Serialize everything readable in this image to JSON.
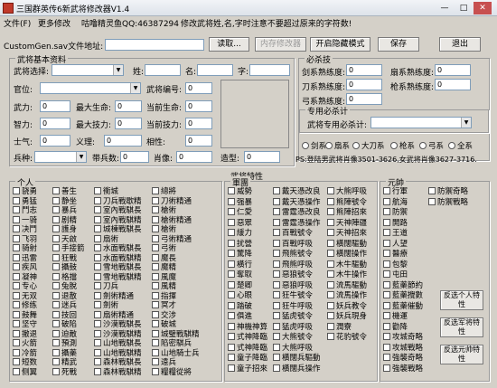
{
  "window": {
    "title": "三国群英传6新武将修改器V1.4",
    "min": "—",
    "max": "□",
    "close": "✕"
  },
  "menu": {
    "file": "文件(F)",
    "more": "更多修改",
    "author": "咕噜精灵鱼QQ:46387294",
    "tip": "修改武将姓,名,字时注意不要超过原来的字符数!"
  },
  "file_row": {
    "label": "CustomGen.sav文件地址:",
    "path": "",
    "read": "读取...",
    "memory": "内存修改器",
    "hidden_mode": "开启隐藏模式",
    "save": "保存",
    "exit": "退出"
  },
  "general": {
    "group": "武将基本资料",
    "select_label": "武将选择:",
    "select_value": "",
    "surname_label": "姓:",
    "name_label": "名:",
    "style_label": "字:",
    "rank_label": "官位:",
    "id_label": "武将编号:",
    "id_value": "0",
    "force_label": "武力:",
    "force": "0",
    "maxhp_label": "最大生命:",
    "maxhp": "0",
    "hp_label": "当前生命:",
    "hp": "0",
    "intel_label": "智力:",
    "intel": "0",
    "maxsp_label": "最大技力:",
    "maxsp": "0",
    "sp_label": "当前技力:",
    "sp": "0",
    "morale_label": "士气:",
    "morale": "0",
    "loyalty_label": "义理:",
    "loyalty": "0",
    "affinity_label": "相性:",
    "affinity": "0",
    "troop_label": "兵种:",
    "troops_label": "带兵数:",
    "troops": "0",
    "portrait_label": "肖像:",
    "portrait": "0",
    "model_label": "造型:",
    "model": "0"
  },
  "skill": {
    "group": "必杀技",
    "sword_label": "剑系熟练度:",
    "sword": "0",
    "fan_label": "扇系熟练度:",
    "fan": "0",
    "blade_label": "刀系熟练度:",
    "blade": "0",
    "spear_label": "枪系熟练度:",
    "spear": "0",
    "bow_label": "弓系熟练度:",
    "bow": "0",
    "sub_group": "专用必杀计",
    "sub_label": "武将专用必杀计:",
    "sub_value": "",
    "radios": [
      "剑系",
      "扇系",
      "大刀系",
      "枪系",
      "弓系",
      "全系"
    ],
    "note": "PS:登陆男武将肖像3501-3626,女武将肖像3627-3716."
  },
  "traits": {
    "group": "武将特性",
    "individual": {
      "title": "个人",
      "cols": [
        [
          "骁勇",
          "勇猛",
          "鬥志",
          "一骑",
          "决鬥",
          "飞羽",
          "骑射",
          "迅雷",
          "疾风",
          "凝神",
          "专心",
          "无双",
          "修练",
          "鼓舞",
          "坚守",
          "撤退",
          "火箭",
          "冷箭",
          "短数",
          "侧翼"
        ],
        [
          "善生",
          "静坐",
          "暴兵",
          "剧精",
          "護身",
          "天啟",
          "手接箭",
          "狂戰",
          "攝鼓",
          "格擋",
          "兔脫",
          "退散",
          "迷兵",
          "技回",
          "破陷",
          "迫敵",
          "預測",
          "攝藥",
          "精武",
          "死戰"
        ],
        [
          "衝城",
          "刀兵戰歇精",
          "室內戰騏長",
          "室內戰騏精",
          "城棟戰騏長",
          "扇術",
          "水面戰騏長",
          "水面戰騏精",
          "雪地戰騏長",
          "雪地戰騏精",
          "刀兵",
          "劍術精通",
          "劍術",
          "扇術精通",
          "沙漠戰騏長",
          "沙漠戰騏精",
          "山地戰騏長",
          "山地戰騏精",
          "森林戰騏長",
          "森林戰騏精"
        ],
        [
          "總將",
          "刀術精通",
          "槍術",
          "槍術精通",
          "槍術",
          "弓術精通",
          "弓術",
          "魔長",
          "魔精",
          "風魔",
          "風精",
          "指揮",
          "冥才",
          "交涉",
          "破城",
          "城璧戰騏精",
          "陷密騏兵",
          "山地騎士兵",
          "遠兵",
          "糧糧從將"
        ]
      ]
    },
    "army": {
      "title": "軍團",
      "cols": [
        [
          "威勢",
          "强暴",
          "仁愛",
          "惡眾",
          "緩力",
          "扰營",
          "驚降",
          "橫行",
          "奪取",
          "楚卿",
          "心眼",
          "踏破",
          "俱進",
          "神機神算",
          "式神降臨",
          "式神降臨",
          "童子降臨",
          "童子招來"
        ],
        [
          "戴天憑改良",
          "戴天憑操作",
          "雷霆憑改良",
          "雷霆憑操作",
          "百戰號令",
          "百戰呼吸",
          "飛熊號令",
          "飛熊呼吸",
          "惡狼號令",
          "惡狼呼吸",
          "狂牛號令",
          "狂牛呼吸",
          "猛虎號令",
          "猛虎呼吸",
          "大熊號令",
          "大熊呼吸",
          "橫闊兵驅動",
          "橫闊兵操作"
        ],
        [
          "大熊呼吸",
          "熊陣號令",
          "熊陣招來",
          "天神陣疆",
          "天神招來",
          "橫闊驅動",
          "橫闊操作",
          "木牛驅動",
          "木牛操作",
          "流馬驅動",
          "流馬操作",
          "妖兵教令",
          "妖兵現身",
          "潤寮",
          "花豹號令"
        ]
      ]
    },
    "attack": {
      "title": "元帥",
      "col": [
        "行軍",
        "航海",
        "防禦",
        "開路",
        "王道",
        "人望",
        "醫療",
        "包黎",
        "屯田",
        "藍藥節約",
        "藍藥攪數",
        "藍藥催動",
        "機運",
        "勸降",
        "攻城奇略",
        "攻城戰略",
        "強襲奇略",
        "強襲戰略"
      ],
      "col2": [
        "防禦奇略",
        "防禦戰略"
      ],
      "btn1": "反选个人特性",
      "btn2": "反选军将特性",
      "btn3": "反选元帅特性"
    }
  }
}
